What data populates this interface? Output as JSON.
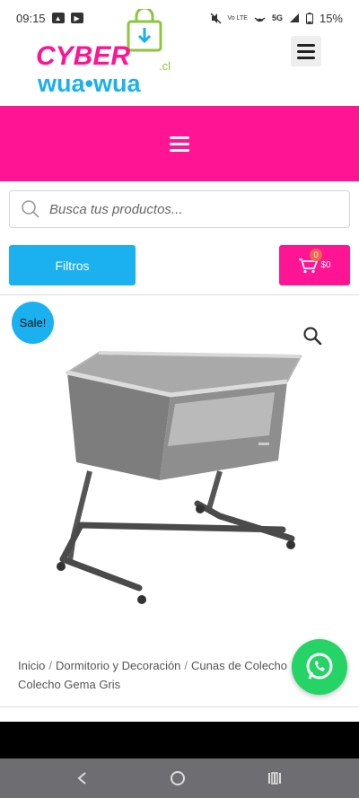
{
  "status_bar": {
    "time": "09:15",
    "network_label": "5G",
    "battery": "15%",
    "volte_label": "Vo LTE"
  },
  "header": {
    "logo_line1": "CYBER",
    "logo_line2": "wua•wua",
    "logo_suffix": ".cl"
  },
  "search": {
    "placeholder": "Busca tus productos..."
  },
  "filters": {
    "label": "Filtros"
  },
  "cart": {
    "count": "0",
    "total": "$0"
  },
  "product": {
    "sale_badge": "Sale!"
  },
  "breadcrumb": {
    "items": [
      "Inicio",
      "Dormitorio y Decoración",
      "Cunas de Colecho"
    ],
    "current": "Colecho Gema Gris"
  },
  "colors": {
    "brand_pink": "#ff1493",
    "accent_blue": "#1bb0f0",
    "whatsapp_green": "#25d366"
  }
}
